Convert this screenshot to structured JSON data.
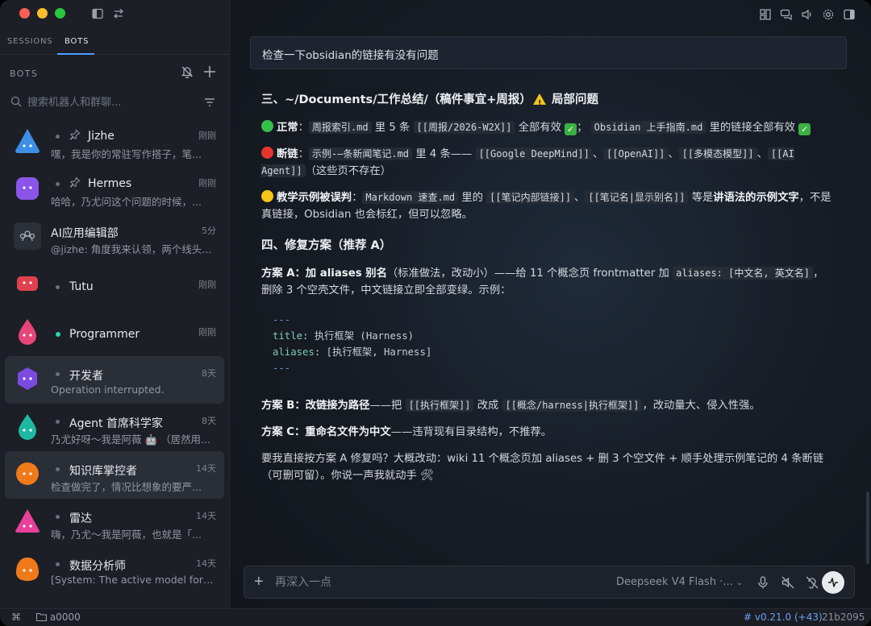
{
  "sidebar": {
    "tabs": [
      {
        "label": "SESSIONS",
        "active": false
      },
      {
        "label": "BOTS",
        "active": true
      }
    ],
    "section_title": "BOTS",
    "search_placeholder": "搜索机器人和群聊...",
    "bots": [
      {
        "name": "Jizhe",
        "time": "刚刚",
        "preview": "嘿，我是你的常驻写作搭子，笔...",
        "pinned": true,
        "online": false,
        "avatar": "drop-blue",
        "color": "#3d8fe6",
        "selected": false
      },
      {
        "name": "Hermes",
        "time": "刚刚",
        "preview": "哈哈，乃尤问这个问题的时候，...",
        "pinned": true,
        "online": false,
        "avatar": "rounded-purple",
        "color": "#8a55e8",
        "selected": false
      },
      {
        "name": "AI应用编辑部",
        "time": "5分",
        "preview": "@jizhe: 角度我来认领，两个线头...",
        "pinned": false,
        "online": false,
        "avatar": "group",
        "color": "#2a2f38",
        "selected": false
      },
      {
        "name": "Tutu",
        "time": "刚刚",
        "preview": "",
        "pinned": false,
        "online": false,
        "avatar": "rounded-red",
        "color": "#e0404f",
        "selected": false
      },
      {
        "name": "Programmer",
        "time": "刚刚",
        "preview": "",
        "pinned": false,
        "online": true,
        "avatar": "drop-pink",
        "color": "#e8457a",
        "selected": false
      },
      {
        "name": "开发者",
        "time": "8天",
        "preview": "Operation interrupted.",
        "pinned": false,
        "online": false,
        "avatar": "hex-purple",
        "color": "#7b4be0",
        "selected": true
      },
      {
        "name": "Agent 首席科学家",
        "time": "8天",
        "preview": "乃尤好呀～我是阿薇 🤖 （居然用...",
        "pinned": false,
        "online": false,
        "avatar": "drop-teal",
        "color": "#1fb8a0",
        "selected": false
      },
      {
        "name": "知识库掌控者",
        "time": "14天",
        "preview": "检查做完了，情况比想象的要严...",
        "pinned": false,
        "online": false,
        "avatar": "circle-orange",
        "color": "#f07a1a",
        "selected": true
      },
      {
        "name": "雷达",
        "time": "14天",
        "preview": "嗨，乃尤～我是阿薇，也就是「...",
        "pinned": false,
        "online": false,
        "avatar": "tri-pink",
        "color": "#e8409a",
        "selected": false
      },
      {
        "name": "数据分析师",
        "time": "14天",
        "preview": "[System: The active model for t...",
        "pinned": false,
        "online": false,
        "avatar": "blob-orange",
        "color": "#f07a1a",
        "selected": false
      }
    ]
  },
  "chat": {
    "user_message": "检查一下obsidian的链接有没有问题",
    "h3_1": "三、~/Documents/工作总结/（稿件事宜+周报）",
    "h3_1_tail": "局部问题",
    "ok_label": "正常",
    "ok_text_1": "：",
    "ok_code_1": "周报索引.md",
    "ok_text_2": " 里 5 条 ",
    "ok_code_2": "[[周报/2026-W2X]]",
    "ok_text_3": " 全部有效 ",
    "ok_text_4": "； ",
    "ok_code_3": "Obsidian 上手指南.md",
    "ok_text_5": " 里的链接全部有效 ",
    "bad_label": "断链",
    "bad_text_1": "：",
    "bad_code_1": "示例-—条新闻笔记.md",
    "bad_text_2": " 里 4 条—— ",
    "bad_code_2": "[[Google DeepMind]]",
    "bad_sep": "、",
    "bad_code_3": "[[OpenAI]]",
    "bad_code_4": "[[多模态模型]]",
    "bad_code_5": "[[AI Agent]]",
    "bad_text_3": "（这些页不存在）",
    "warn_label": "教学示例被误判",
    "warn_text_1": "：",
    "warn_code_1": "Markdown 速查.md",
    "warn_text_2": " 里的 ",
    "warn_code_2": "[[笔记内部链接]]",
    "warn_code_3": "[[笔记名|显示别名]]",
    "warn_text_3": " 等是",
    "warn_bold": "讲语法的示例文字",
    "warn_text_4": "，不是真链接，Obsidian 也会标红，但可以忽略。",
    "h3_2": "四、修复方案（推荐 A）",
    "planA_label": "方案 A：加 aliases 别名",
    "planA_text_1": "（标准做法，改动小）——给 11 个概念页 frontmatter 加 ",
    "planA_code": "aliases: [中文名, 英文名]",
    "planA_text_2": "，删除 3 个空壳文件，中文链接立即全部变绿。示例：",
    "code_dash": "---",
    "code_title_key": "title",
    "code_title_val": ": 执行框架 (Harness)",
    "code_alias_key": "aliases",
    "code_alias_val": ": [执行框架, Harness]",
    "planB_label": "方案 B：改链接为路径",
    "planB_text_1": "——把 ",
    "planB_code_1": "[[执行框架]]",
    "planB_text_2": " 改成 ",
    "planB_code_2": "[[概念/harness|执行框架]]",
    "planB_text_3": "，改动量大、侵入性强。",
    "planC_label": "方案 C：重命名文件为中文",
    "planC_text": "——违背现有目录结构，不推荐。",
    "closing": "要我直接按方案 A 修复吗？大概改动：wiki 11 个概念页加 aliases + 删 3 个空文件 + 顺手处理示例笔记的 4 条断链（可删可留）。你说一声我就动手 🛠"
  },
  "composer": {
    "placeholder": "再深入一点",
    "model": "Deepseek V4 Flash ·..."
  },
  "statusbar": {
    "workspace": "a0000",
    "version": "# v0.21.0 (+43)",
    "commit": "21b2095"
  },
  "colors": {
    "accent": "#4a9eff",
    "online": "#2bd4b0"
  }
}
